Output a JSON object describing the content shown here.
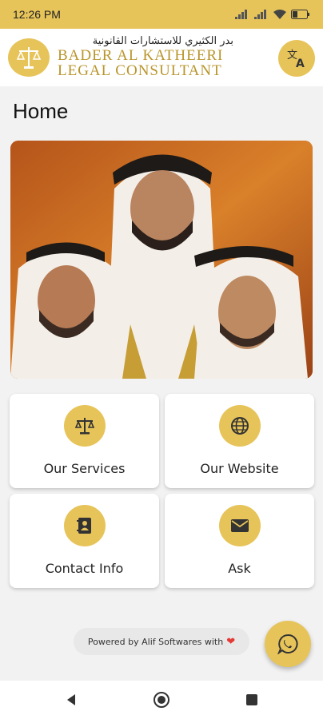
{
  "status_bar": {
    "time": "12:26 PM",
    "icons": [
      "signal-icon",
      "signal-icon",
      "wifi-icon",
      "battery-icon"
    ]
  },
  "header": {
    "logo_arabic": "بدر الكثيري للاستشارات القانونية",
    "logo_line1": "BADER AL KATHEERI",
    "logo_line2": "LEGAL CONSULTANT",
    "translate_icon": "translate-icon"
  },
  "page": {
    "title": "Home"
  },
  "hero": {
    "image": "portrait-photo"
  },
  "cards": [
    {
      "label": "Our Services",
      "icon": "scale-icon"
    },
    {
      "label": "Our Website",
      "icon": "globe-icon"
    },
    {
      "label": "Contact Info",
      "icon": "contact-book-icon"
    },
    {
      "label": "Ask",
      "icon": "mail-icon"
    }
  ],
  "footer": {
    "powered_text": "Powered by Alif Softwares with",
    "heart": "❤"
  },
  "fab": {
    "icon": "whatsapp-icon"
  },
  "colors": {
    "accent": "#e7c45a",
    "gold_text": "#b9952b"
  }
}
